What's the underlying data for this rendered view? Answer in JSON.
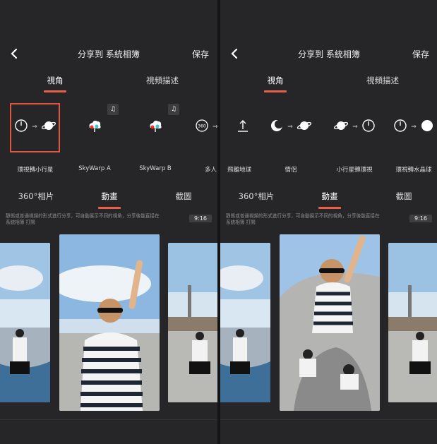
{
  "left": {
    "header": {
      "title": "分享到 系統相簿",
      "save_label": "保存"
    },
    "top_tabs": [
      {
        "label": "視角",
        "active": true
      },
      {
        "label": "視頻描述",
        "active": false
      }
    ],
    "effects": [
      {
        "name": "環視轉小行星",
        "selected": true,
        "music": false,
        "icons": [
          "circle-arrow",
          "planet"
        ]
      },
      {
        "name": "SkyWarp A",
        "selected": false,
        "music": true,
        "icons": [
          "skywarp"
        ]
      },
      {
        "name": "SkyWarp B",
        "selected": false,
        "music": true,
        "icons": [
          "skywarp"
        ]
      },
      {
        "name": "多人",
        "selected": false,
        "music": false,
        "icons": [
          "360",
          "arrow"
        ]
      }
    ],
    "mid_tabs": [
      {
        "label": "360°相片",
        "active": false
      },
      {
        "label": "動畫",
        "active": true
      },
      {
        "label": "截圖",
        "active": false
      }
    ],
    "description": "靜態或普通視頻的形式進行分享，可自動展示不同的視角，分享後能直接在系統相簿 打開",
    "ratio": "9:16"
  },
  "right": {
    "header": {
      "title": "分享到 系統相簿",
      "save_label": "保存"
    },
    "top_tabs": [
      {
        "label": "視角",
        "active": true
      },
      {
        "label": "視頻描述",
        "active": false
      }
    ],
    "effects": [
      {
        "name": "飛離地球",
        "selected": false,
        "music": false,
        "icons": [
          "up-arrow"
        ]
      },
      {
        "name": "情侶",
        "selected": false,
        "music": false,
        "icons": [
          "moon",
          "planet"
        ]
      },
      {
        "name": "小行星轉環視",
        "selected": false,
        "music": false,
        "icons": [
          "planet",
          "circle-arrow"
        ]
      },
      {
        "name": "環視轉水晶球",
        "selected": false,
        "music": false,
        "icons": [
          "circle-arrow",
          "ball"
        ]
      }
    ],
    "mid_tabs": [
      {
        "label": "360°相片",
        "active": false
      },
      {
        "label": "動畫",
        "active": true
      },
      {
        "label": "截圖",
        "active": false
      }
    ],
    "description": "靜態或普通視頻的形式進行分享，可自動展示不同的視角，分享後能直接在系統相簿 打開",
    "ratio": "9:16"
  },
  "colors": {
    "accent": "#e8604a",
    "background": "#262628",
    "text": "#eeeeee"
  },
  "icons": {
    "back": "chevron-left-icon",
    "music": "music-note-icon",
    "effect_glyphs": {
      "arrow": "⇒"
    }
  }
}
